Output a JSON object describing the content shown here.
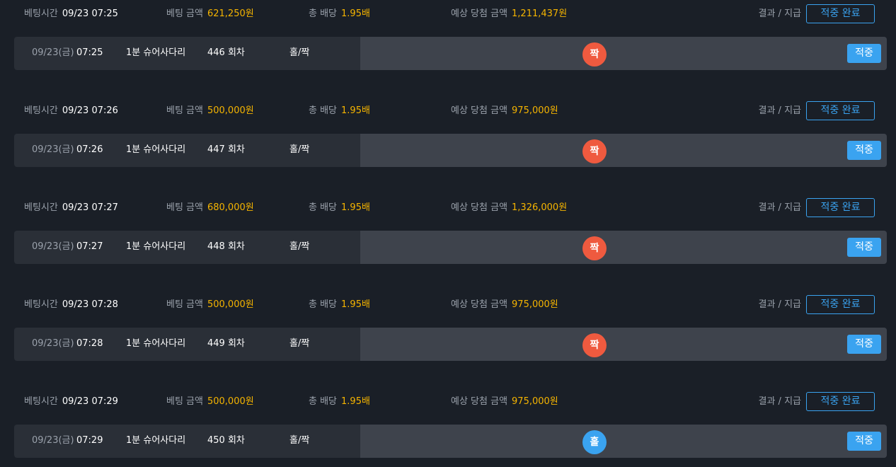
{
  "labels": {
    "bet_time": "베팅시간",
    "bet_amount": "베팅 금액",
    "total_odds": "총 배당",
    "expected_win": "예상 당첨 금액",
    "result_payout": "결과 / 지급",
    "complete_button": "적중 완료",
    "hit_badge": "적중"
  },
  "colors": {
    "ball_even": "#ef5a3f",
    "ball_odd": "#3aa3f0"
  },
  "bets": [
    {
      "bet_time": "09/23 07:25",
      "bet_amount": "621,250원",
      "odds": "1.95배",
      "expected_win": "1,211,437원",
      "date": "09/23(금)",
      "time": "07:25",
      "game": "1분 슈어사다리",
      "round": "446 회차",
      "pick": "홀/짝",
      "result": "짝",
      "result_color": "#ef5a3f"
    },
    {
      "bet_time": "09/23 07:26",
      "bet_amount": "500,000원",
      "odds": "1.95배",
      "expected_win": "975,000원",
      "date": "09/23(금)",
      "time": "07:26",
      "game": "1분 슈어사다리",
      "round": "447 회차",
      "pick": "홀/짝",
      "result": "짝",
      "result_color": "#ef5a3f"
    },
    {
      "bet_time": "09/23 07:27",
      "bet_amount": "680,000원",
      "odds": "1.95배",
      "expected_win": "1,326,000원",
      "date": "09/23(금)",
      "time": "07:27",
      "game": "1분 슈어사다리",
      "round": "448 회차",
      "pick": "홀/짝",
      "result": "짝",
      "result_color": "#ef5a3f"
    },
    {
      "bet_time": "09/23 07:28",
      "bet_amount": "500,000원",
      "odds": "1.95배",
      "expected_win": "975,000원",
      "date": "09/23(금)",
      "time": "07:28",
      "game": "1분 슈어사다리",
      "round": "449 회차",
      "pick": "홀/짝",
      "result": "짝",
      "result_color": "#ef5a3f"
    },
    {
      "bet_time": "09/23 07:29",
      "bet_amount": "500,000원",
      "odds": "1.95배",
      "expected_win": "975,000원",
      "date": "09/23(금)",
      "time": "07:29",
      "game": "1분 슈어사다리",
      "round": "450 회차",
      "pick": "홀/짝",
      "result": "홀",
      "result_color": "#3aa3f0"
    }
  ]
}
